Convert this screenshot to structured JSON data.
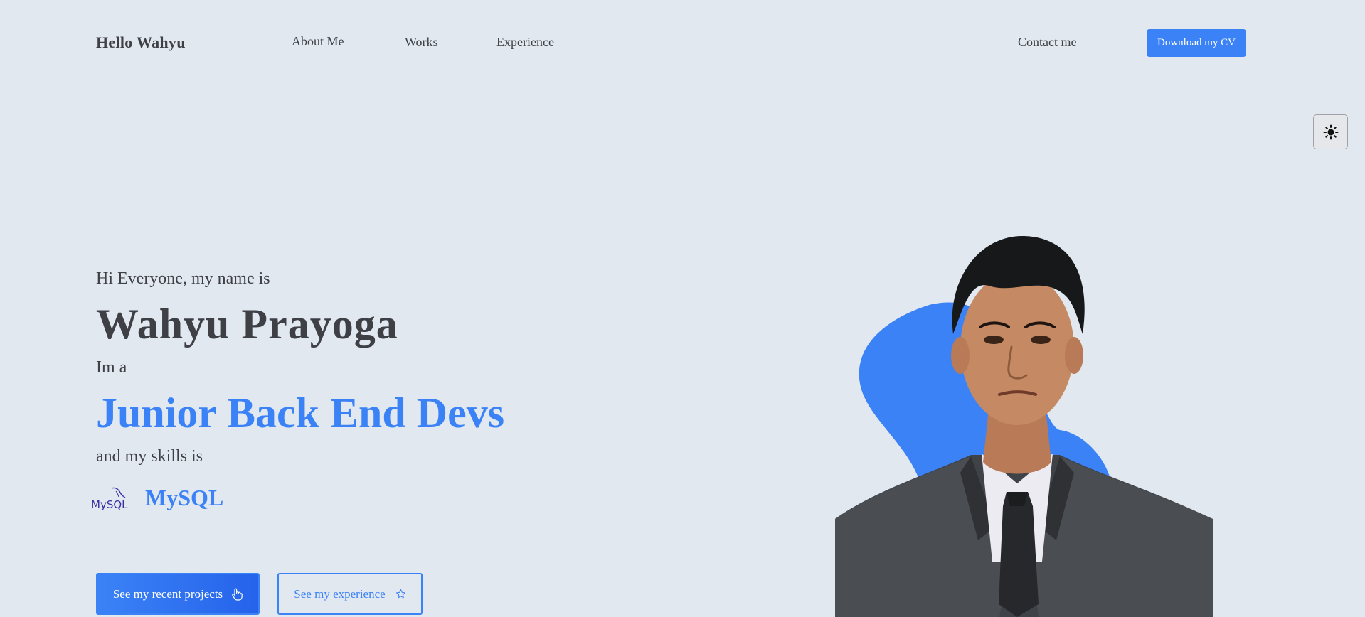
{
  "nav": {
    "logo": "Hello Wahyu",
    "links": [
      "About Me",
      "Works",
      "Experience"
    ],
    "contact": "Contact me",
    "download_cv": "Download my CV"
  },
  "theme_toggle": {
    "icon": "sun-icon"
  },
  "hero": {
    "greeting": "Hi Everyone, my name is",
    "name": "Wahyu Prayoga",
    "im_a": "Im a",
    "role": "Junior Back End Devs",
    "skills_intro": "and my skills is",
    "skill": {
      "name": "MySQL",
      "logo_text": "MySQL",
      "icon": "mysql-logo-icon"
    },
    "primary_button": {
      "label": "See my recent projects",
      "icon": "hand-pointer-icon"
    },
    "secondary_button": {
      "label": "See my experience",
      "icon": "star-outline-icon"
    }
  },
  "colors": {
    "background": "#e2e8f0",
    "accent": "#3b82f6",
    "text": "#3f3f46"
  }
}
